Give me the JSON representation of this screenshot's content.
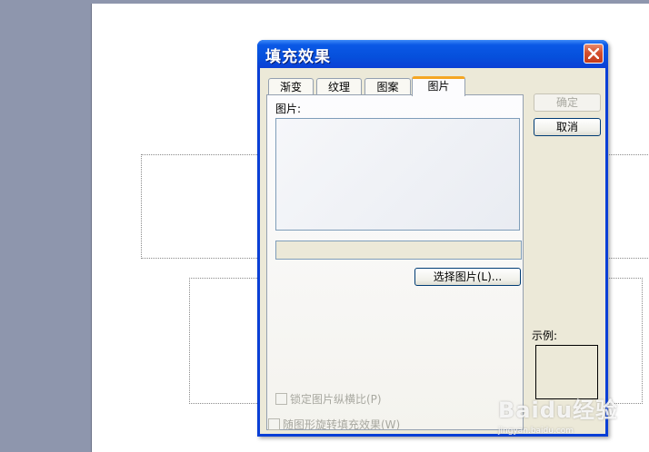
{
  "dialog": {
    "title": "填充效果",
    "tabs": [
      {
        "label": "渐变",
        "active": false
      },
      {
        "label": "纹理",
        "active": false
      },
      {
        "label": "图案",
        "active": false
      },
      {
        "label": "图片",
        "active": true
      }
    ],
    "picture_label": "图片:",
    "choose_picture_button": "选择图片(L)...",
    "lock_aspect_checkbox": {
      "label": "锁定图片纵横比(P)",
      "checked": false,
      "enabled": false
    },
    "rotate_with_shape_checkbox": {
      "label": "随图形旋转填充效果(W)",
      "checked": false,
      "enabled": false
    },
    "ok_button": "确定",
    "cancel_button": "取消",
    "example_label": "示例:"
  },
  "watermark": {
    "main": "Baidu经验",
    "sub": "jingyan.baidu.com"
  },
  "colors": {
    "title_bar": "#0a58e6",
    "close_button": "#d4502e",
    "dialog_body": "#ece9d8",
    "active_tab_accent": "#f5a623"
  }
}
